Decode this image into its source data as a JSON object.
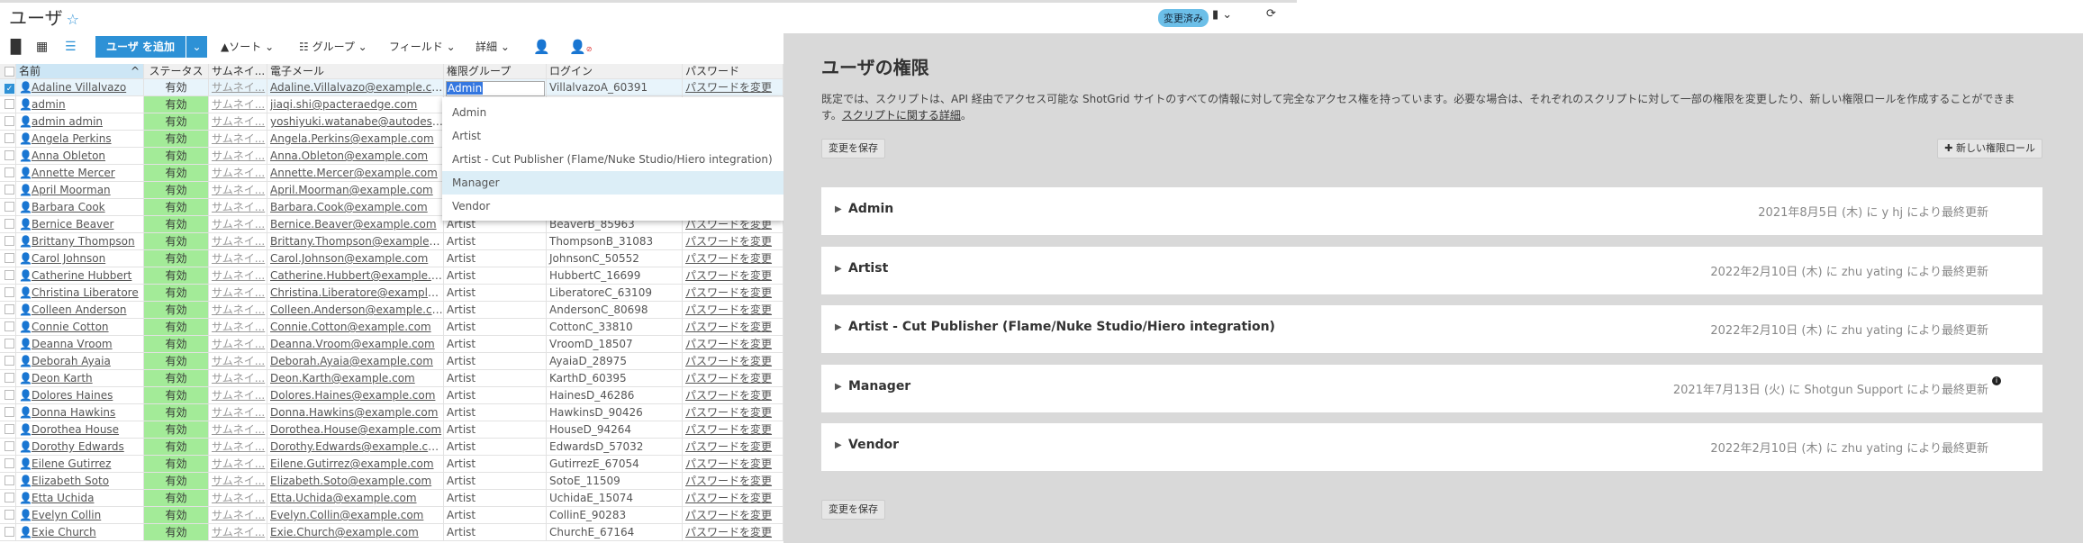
{
  "page": {
    "title": "ユーザ",
    "star": "☆"
  },
  "header": {
    "modified_badge": "変更済み"
  },
  "toolbar": {
    "add_user": "ユーザ を追加",
    "sort": "ソート",
    "group": "グループ",
    "fields": "フィールド",
    "details": "詳細"
  },
  "columns": [
    "名前",
    "ステータス",
    "サムネイ...",
    "電子メール",
    "権限グループ",
    "ログイン",
    "パスワード"
  ],
  "editing": {
    "value": "Admin"
  },
  "dropdown": {
    "options": [
      "Admin",
      "Artist",
      "Artist - Cut Publisher (Flame/Nuke Studio/Hiero integration)",
      "Manager",
      "Vendor"
    ],
    "highlighted": "Manager"
  },
  "rows": [
    {
      "name": "Adaline Villalvazo",
      "status": "有効",
      "thumb": "サムネイ...",
      "email": "Adaline.Villalvazo@example.com",
      "group": "",
      "login": "VillalvazoA_60391",
      "password": "パスワードを変更",
      "selected": true
    },
    {
      "name": "admin",
      "status": "有効",
      "thumb": "サムネイ...",
      "email": "jiaqi.shi@pacteraedge.com",
      "group": "",
      "login": "",
      "password": ""
    },
    {
      "name": "admin admin",
      "status": "有効",
      "thumb": "サムネイ...",
      "email": "yoshiyuki.watanabe@autodesk...",
      "group": "",
      "login": "",
      "password": ""
    },
    {
      "name": "Angela Perkins",
      "status": "有効",
      "thumb": "サムネイ...",
      "email": "Angela.Perkins@example.com",
      "group": "",
      "login": "",
      "password": ""
    },
    {
      "name": "Anna Obleton",
      "status": "有効",
      "thumb": "サムネイ...",
      "email": "Anna.Obleton@example.com",
      "group": "",
      "login": "",
      "password": ""
    },
    {
      "name": "Annette Mercer",
      "status": "有効",
      "thumb": "サムネイ...",
      "email": "Annette.Mercer@example.com",
      "group": "",
      "login": "",
      "password": ""
    },
    {
      "name": "April Moorman",
      "status": "有効",
      "thumb": "サムネイ...",
      "email": "April.Moorman@example.com",
      "group": "",
      "login": "",
      "password": ""
    },
    {
      "name": "Barbara Cook",
      "status": "有効",
      "thumb": "サムネイ...",
      "email": "Barbara.Cook@example.com",
      "group": "",
      "login": "",
      "password": ""
    },
    {
      "name": "Bernice Beaver",
      "status": "有効",
      "thumb": "サムネイ...",
      "email": "Bernice.Beaver@example.com",
      "group": "Artist",
      "login": "BeaverB_85963",
      "password": "パスワードを変更"
    },
    {
      "name": "Brittany Thompson",
      "status": "有効",
      "thumb": "サムネイ...",
      "email": "Brittany.Thompson@example.co...",
      "group": "Artist",
      "login": "ThompsonB_31083",
      "password": "パスワードを変更"
    },
    {
      "name": "Carol Johnson",
      "status": "有効",
      "thumb": "サムネイ...",
      "email": "Carol.Johnson@example.com",
      "group": "Artist",
      "login": "JohnsonC_50552",
      "password": "パスワードを変更"
    },
    {
      "name": "Catherine Hubbert",
      "status": "有効",
      "thumb": "サムネイ...",
      "email": "Catherine.Hubbert@example.co...",
      "group": "Artist",
      "login": "HubbertC_16699",
      "password": "パスワードを変更"
    },
    {
      "name": "Christina Liberatore",
      "status": "有効",
      "thumb": "サムネイ...",
      "email": "Christina.Liberatore@example.c...",
      "group": "Artist",
      "login": "LiberatoreC_63109",
      "password": "パスワードを変更"
    },
    {
      "name": "Colleen Anderson",
      "status": "有効",
      "thumb": "サムネイ...",
      "email": "Colleen.Anderson@example.com",
      "group": "Artist",
      "login": "AndersonC_80698",
      "password": "パスワードを変更"
    },
    {
      "name": "Connie Cotton",
      "status": "有効",
      "thumb": "サムネイ...",
      "email": "Connie.Cotton@example.com",
      "group": "Artist",
      "login": "CottonC_33810",
      "password": "パスワードを変更"
    },
    {
      "name": "Deanna Vroom",
      "status": "有効",
      "thumb": "サムネイ...",
      "email": "Deanna.Vroom@example.com",
      "group": "Artist",
      "login": "VroomD_18507",
      "password": "パスワードを変更"
    },
    {
      "name": "Deborah Ayaia",
      "status": "有効",
      "thumb": "サムネイ...",
      "email": "Deborah.Ayaia@example.com",
      "group": "Artist",
      "login": "AyaiaD_28975",
      "password": "パスワードを変更"
    },
    {
      "name": "Deon Karth",
      "status": "有効",
      "thumb": "サムネイ...",
      "email": "Deon.Karth@example.com",
      "group": "Artist",
      "login": "KarthD_60395",
      "password": "パスワードを変更"
    },
    {
      "name": "Dolores Haines",
      "status": "有効",
      "thumb": "サムネイ...",
      "email": "Dolores.Haines@example.com",
      "group": "Artist",
      "login": "HainesD_46286",
      "password": "パスワードを変更"
    },
    {
      "name": "Donna Hawkins",
      "status": "有効",
      "thumb": "サムネイ...",
      "email": "Donna.Hawkins@example.com",
      "group": "Artist",
      "login": "HawkinsD_90426",
      "password": "パスワードを変更"
    },
    {
      "name": "Dorothea House",
      "status": "有効",
      "thumb": "サムネイ...",
      "email": "Dorothea.House@example.com",
      "group": "Artist",
      "login": "HouseD_94264",
      "password": "パスワードを変更"
    },
    {
      "name": "Dorothy Edwards",
      "status": "有効",
      "thumb": "サムネイ...",
      "email": "Dorothy.Edwards@example.com",
      "group": "Artist",
      "login": "EdwardsD_57032",
      "password": "パスワードを変更"
    },
    {
      "name": "Eilene Gutirrez",
      "status": "有効",
      "thumb": "サムネイ...",
      "email": "Eilene.Gutirrez@example.com",
      "group": "Artist",
      "login": "GutirrezE_67054",
      "password": "パスワードを変更"
    },
    {
      "name": "Elizabeth Soto",
      "status": "有効",
      "thumb": "サムネイ...",
      "email": "Elizabeth.Soto@example.com",
      "group": "Artist",
      "login": "SotoE_11509",
      "password": "パスワードを変更"
    },
    {
      "name": "Etta Uchida",
      "status": "有効",
      "thumb": "サムネイ...",
      "email": "Etta.Uchida@example.com",
      "group": "Artist",
      "login": "UchidaE_15074",
      "password": "パスワードを変更"
    },
    {
      "name": "Evelyn Collin",
      "status": "有効",
      "thumb": "サムネイ...",
      "email": "Evelyn.Collin@example.com",
      "group": "Artist",
      "login": "CollinE_90283",
      "password": "パスワードを変更"
    },
    {
      "name": "Exie Church",
      "status": "有効",
      "thumb": "サムネイ...",
      "email": "Exie.Church@example.com",
      "group": "Artist",
      "login": "ChurchE_67164",
      "password": "パスワードを変更"
    }
  ],
  "permissions": {
    "title": "ユーザの権限",
    "description": "既定では、スクリプトは、API 経由でアクセス可能な ShotGrid サイトのすべての情報に対して完全なアクセス権を持っています。必要な場合は、それぞれのスクリプトに対して一部の権限を変更したり、新しい権限ロールを作成することができます。",
    "learn_more": "スクリプトに関する詳細",
    "period": "。",
    "save": "変更を保存",
    "new_role": "新しい権限ロール",
    "roles": [
      {
        "name": "Admin",
        "updated": "2021年8月5日 (木) に y hj により最終更新"
      },
      {
        "name": "Artist",
        "updated": "2022年2月10日 (木) に zhu yating により最終更新"
      },
      {
        "name": "Artist - Cut Publisher (Flame/Nuke Studio/Hiero integration)",
        "updated": "2022年2月10日 (木) に zhu yating により最終更新"
      },
      {
        "name": "Manager",
        "updated": "2021年7月13日 (火) に Shotgun Support により最終更新",
        "info": true
      },
      {
        "name": "Vendor",
        "updated": "2022年2月10日 (木) に zhu yating により最終更新"
      }
    ]
  }
}
